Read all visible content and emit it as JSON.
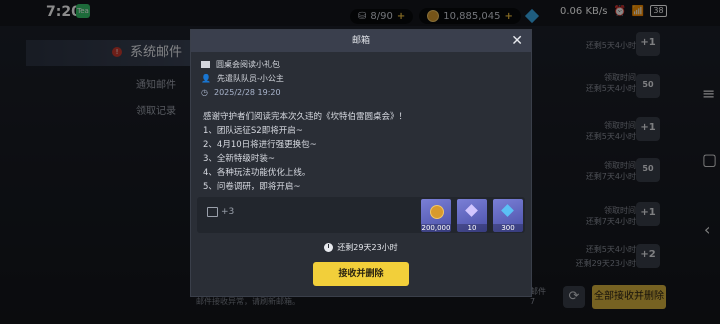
{
  "status": {
    "time": "7:20",
    "app_badge": "Tea",
    "net_speed": "0.06 KB/s",
    "battery": "38"
  },
  "topbar": {
    "stamina": "8/90",
    "coins": "10,885,045"
  },
  "sidebar": {
    "active_label": "系统邮件",
    "items": [
      {
        "label": "通知邮件"
      },
      {
        "label": "领取记录"
      }
    ]
  },
  "mail_list": [
    {
      "time": "还剩5天4小时",
      "badge": "+1"
    },
    {
      "time": "领取时间\n还剩5天4小时",
      "badge": "50"
    },
    {
      "time": "领取时间\n还剩5天4小时",
      "badge": "+1"
    },
    {
      "time": "领取时间\n还剩7天4小时",
      "badge": "50"
    },
    {
      "time": "领取时间\n还剩7天4小时",
      "badge": "+1"
    },
    {
      "time": "还剩5天4小时",
      "badge": "+2"
    },
    {
      "time": "还剩29天23小时",
      "badge": ""
    }
  ],
  "footer": {
    "info": "邮件接收异常，请刷新邮箱。",
    "count_label": "邮件",
    "count": "7",
    "claim_all": "全部接收并删除"
  },
  "modal": {
    "title": "邮箱",
    "subject": "圆桌会阅读小礼包",
    "sender": "先遣队队员-小公主",
    "date": "2025/2/28 19:20",
    "body": [
      "感谢守护者们阅读完本次久违的《坎特伯雷圆桌会》！",
      "1、团队远征S2即将开启~",
      "2、4月10日将进行强更换包~",
      "3、全新特级时装~",
      "4、各种玩法功能优化上线。",
      "5、问卷调研，即将开启~"
    ],
    "gift_count": "+3",
    "rewards": [
      {
        "amount": "200,000",
        "icon": "coin-icon",
        "color": "#d89a2c"
      },
      {
        "amount": "10",
        "icon": "crystal-icon",
        "color": "#b8a6f5"
      },
      {
        "amount": "300",
        "icon": "gem-icon",
        "color": "#5bc0f5"
      }
    ],
    "expire": "还剩29天23小时",
    "receive_label": "接收并删除"
  }
}
